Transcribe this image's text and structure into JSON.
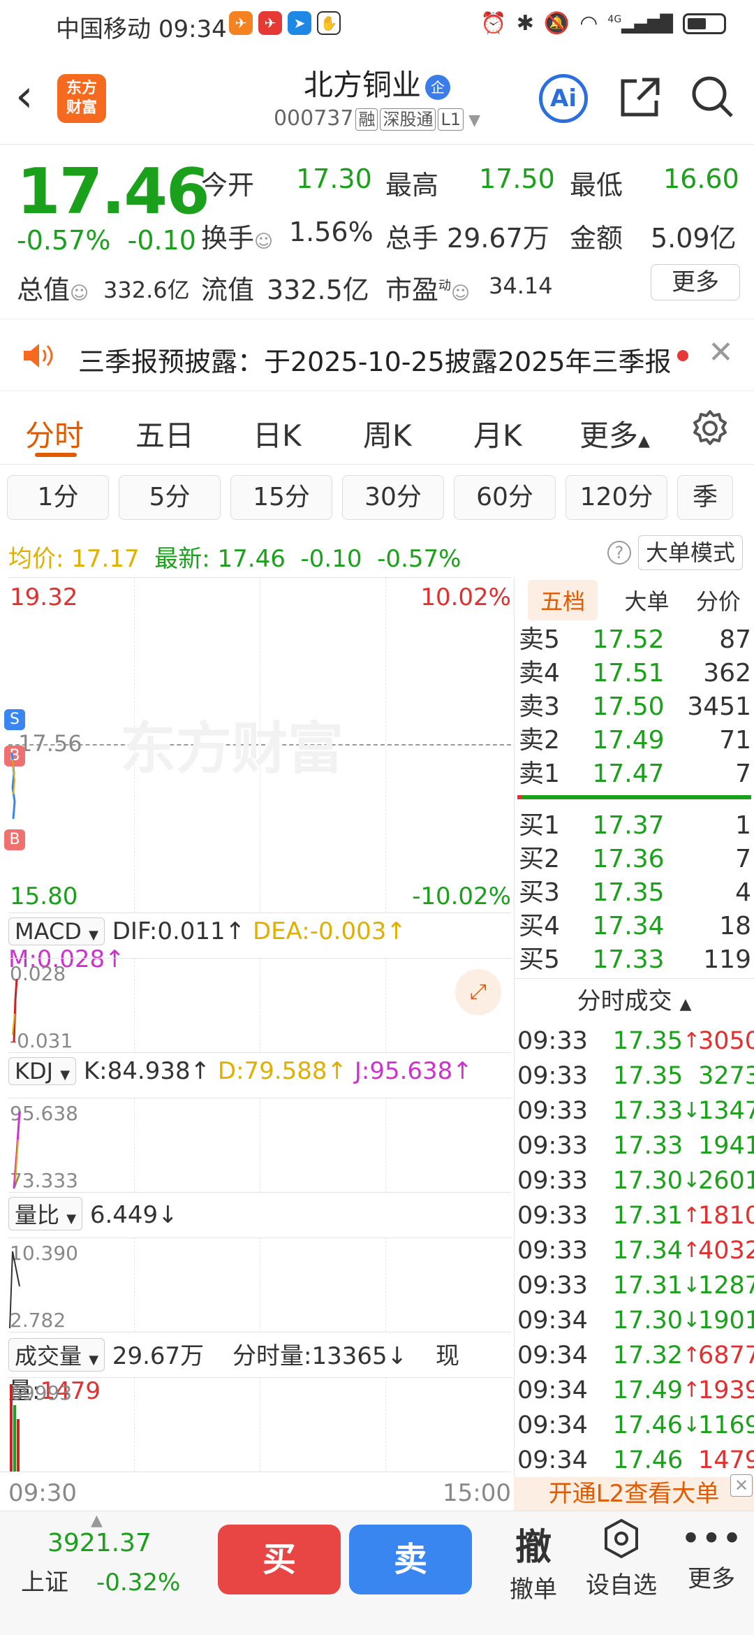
{
  "status_bar": {
    "carrier": "中国移动",
    "time": "09:34",
    "network": "4G"
  },
  "header": {
    "stock_name": "北方铜业",
    "badge": "企",
    "code": "000737",
    "tags": [
      "融",
      "深股通",
      "L1"
    ],
    "logo_text": [
      "东方",
      "财富"
    ],
    "ai_label": "Ai"
  },
  "quote": {
    "price": "17.46",
    "change_pct": "-0.57%",
    "change_abs": "-0.10",
    "open_label": "今开",
    "open": "17.30",
    "high_label": "最高",
    "high": "17.50",
    "low_label": "最低",
    "low": "16.60",
    "turnover_label": "换手",
    "turnover": "1.56%",
    "volume_label": "总手",
    "volume": "29.67万",
    "amount_label": "金额",
    "amount": "5.09亿",
    "mktcap_label": "总值",
    "mktcap": "332.6亿",
    "float_label": "流值",
    "float_cap": "332.5亿",
    "pe_label": "市盈",
    "pe_sup": "动",
    "pe": "34.14",
    "more_label": "更多"
  },
  "notice": {
    "text": "三季报预披露：于2025-10-25披露2025年三季报"
  },
  "tabs": [
    "分时",
    "五日",
    "日K",
    "周K",
    "月K",
    "更多"
  ],
  "periods": [
    "1分",
    "5分",
    "15分",
    "30分",
    "60分",
    "120分",
    "季"
  ],
  "info_row": {
    "avg_label": "均价:",
    "avg": "17.17",
    "latest_label": "最新:",
    "latest": "17.46",
    "chg": "-0.10",
    "pct": "-0.57%",
    "mode_label": "大单模式"
  },
  "main_chart": {
    "top_price": "19.32",
    "top_pct": "10.02%",
    "mid_price": "17.56",
    "bottom_price": "15.80",
    "bottom_pct": "-10.02%",
    "watermark": "东方财富",
    "markers": [
      "S",
      "B",
      "B"
    ]
  },
  "macd": {
    "selector": "MACD",
    "dif": "DIF:0.011",
    "dea": "DEA:-0.003",
    "m": "M:0.028",
    "top": "0.028",
    "bottom": "-0.031"
  },
  "kdj": {
    "selector": "KDJ",
    "k": "K:84.938",
    "d": "D:79.588",
    "j": "J:95.638",
    "top": "95.638",
    "bottom": "73.333"
  },
  "ratio": {
    "selector": "量比",
    "value": "6.449",
    "top": "10.390",
    "bottom": "2.782"
  },
  "volume_panel": {
    "selector": "成交量",
    "total": "29.67万",
    "period_label": "分时量:",
    "period": "13365",
    "now_label": "现量:",
    "now": "1479",
    "top": "69993"
  },
  "time_axis": {
    "start": "09:30",
    "end": "15:00"
  },
  "order_book": {
    "tabs": [
      "五档",
      "大单",
      "分价"
    ],
    "asks": [
      {
        "label": "卖5",
        "price": "17.52",
        "vol": "87"
      },
      {
        "label": "卖4",
        "price": "17.51",
        "vol": "362"
      },
      {
        "label": "卖3",
        "price": "17.50",
        "vol": "3451"
      },
      {
        "label": "卖2",
        "price": "17.49",
        "vol": "71"
      },
      {
        "label": "卖1",
        "price": "17.47",
        "vol": "7"
      }
    ],
    "bids": [
      {
        "label": "买1",
        "price": "17.37",
        "vol": "1"
      },
      {
        "label": "买2",
        "price": "17.36",
        "vol": "7"
      },
      {
        "label": "买3",
        "price": "17.35",
        "vol": "4"
      },
      {
        "label": "买4",
        "price": "17.34",
        "vol": "18"
      },
      {
        "label": "买5",
        "price": "17.33",
        "vol": "119"
      }
    ]
  },
  "trades": {
    "title": "分时成交",
    "rows": [
      {
        "t": "09:33",
        "p": "17.35",
        "dir": "up",
        "v": "3050"
      },
      {
        "t": "09:33",
        "p": "17.35",
        "dir": "none",
        "v": "3273"
      },
      {
        "t": "09:33",
        "p": "17.33",
        "dir": "down",
        "v": "1347"
      },
      {
        "t": "09:33",
        "p": "17.33",
        "dir": "none",
        "v": "1941"
      },
      {
        "t": "09:33",
        "p": "17.30",
        "dir": "down",
        "v": "2601"
      },
      {
        "t": "09:33",
        "p": "17.31",
        "dir": "up",
        "v": "1810"
      },
      {
        "t": "09:33",
        "p": "17.34",
        "dir": "up",
        "v": "4032"
      },
      {
        "t": "09:33",
        "p": "17.31",
        "dir": "down",
        "v": "1287"
      },
      {
        "t": "09:34",
        "p": "17.30",
        "dir": "down",
        "v": "1901"
      },
      {
        "t": "09:34",
        "p": "17.32",
        "dir": "up",
        "v": "6877"
      },
      {
        "t": "09:34",
        "p": "17.49",
        "dir": "up",
        "v": "1939"
      },
      {
        "t": "09:34",
        "p": "17.46",
        "dir": "down",
        "v": "1169"
      },
      {
        "t": "09:34",
        "p": "17.46",
        "dir": "none",
        "v": "1479"
      }
    ],
    "promo": "开通L2查看大单"
  },
  "bottom": {
    "index_value": "3921.37",
    "index_name": "上证",
    "index_pct": "-0.32%",
    "buy": "买",
    "sell": "卖",
    "cancel_icon_char": "撤",
    "cancel": "撤单",
    "watch": "设自选",
    "more": "更多"
  },
  "colors": {
    "up": "#e03030",
    "down": "#1aa01a",
    "accent": "#e05a00",
    "buy": "#e84545",
    "sell": "#3a86f0"
  }
}
